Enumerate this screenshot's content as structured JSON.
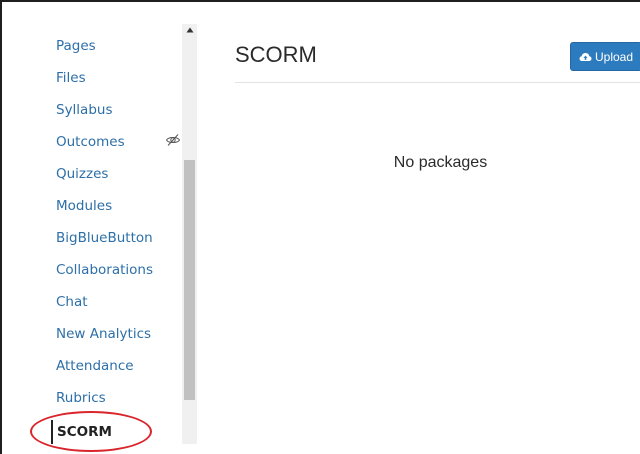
{
  "course_nav": {
    "items": [
      {
        "label": "Pages"
      },
      {
        "label": "Files"
      },
      {
        "label": "Syllabus"
      },
      {
        "label": "Outcomes",
        "hidden_icon": "eye-slash-icon"
      },
      {
        "label": "Quizzes"
      },
      {
        "label": "Modules"
      },
      {
        "label": "BigBlueButton"
      },
      {
        "label": "Collaborations"
      },
      {
        "label": "Chat"
      },
      {
        "label": "New Analytics"
      },
      {
        "label": "Attendance"
      },
      {
        "label": "Rubrics"
      },
      {
        "label": "SCORM",
        "active": true
      }
    ]
  },
  "main": {
    "title": "SCORM",
    "upload_button": {
      "label": "Upload",
      "icon": "cloud-upload-icon"
    },
    "empty_message": "No packages"
  },
  "colors": {
    "link": "#2d6fa8",
    "button": "#2d7bbf",
    "annotation": "#d9262c",
    "text": "#2b2b2b"
  }
}
